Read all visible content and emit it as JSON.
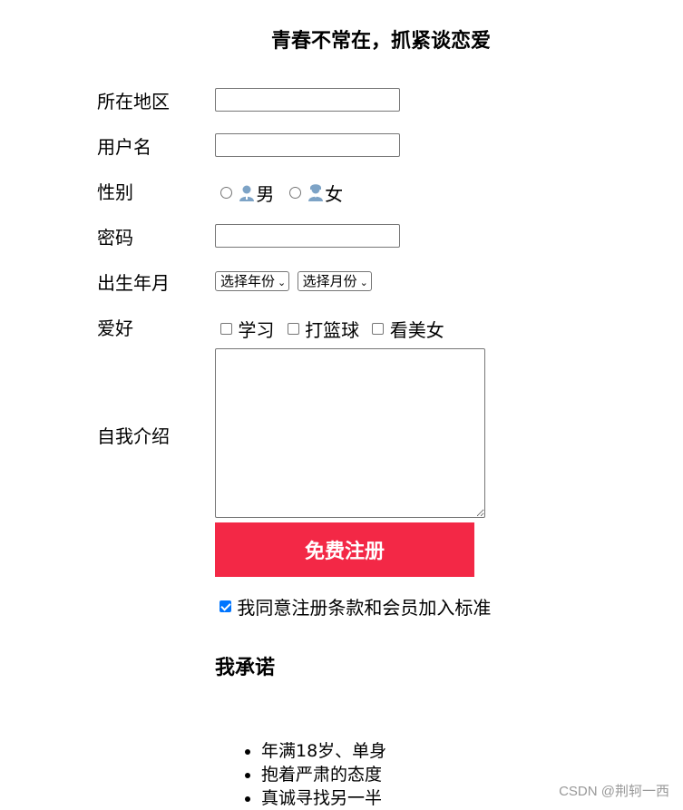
{
  "page": {
    "title": "青春不常在，抓紧谈恋爱"
  },
  "form": {
    "region_label": "所在地区",
    "username_label": "用户名",
    "gender_label": "性别",
    "gender_male": "男",
    "gender_female": "女",
    "password_label": "密码",
    "birth_label": "出生年月",
    "year_select": "选择年份",
    "month_select": "选择月份",
    "hobby_label": "爱好",
    "hobbies": [
      "学习",
      "打篮球",
      "看美女"
    ],
    "intro_label": "自我介绍",
    "submit_label": "免费注册",
    "agree_label": "我同意注册条款和会员加入标准"
  },
  "promise": {
    "title": "我承诺",
    "items": [
      "年满18岁、单身",
      "抱着严肃的态度",
      "真诚寻找另一半"
    ]
  },
  "watermark": "CSDN @荆轲一西",
  "colors": {
    "submit_bg": "#f32846",
    "checkbox_checked": "#0075ff",
    "icon_blue": "#7da3c6"
  }
}
